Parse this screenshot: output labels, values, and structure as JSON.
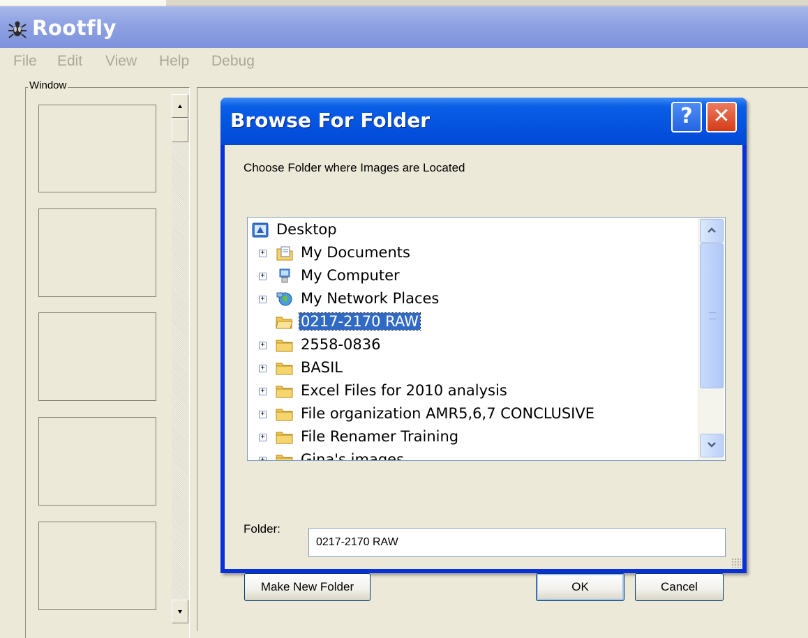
{
  "app": {
    "title": "Rootfly",
    "icon": "bug-icon"
  },
  "menu": {
    "items": [
      {
        "label": "File"
      },
      {
        "label": "Edit"
      },
      {
        "label": "View"
      },
      {
        "label": "Help"
      },
      {
        "label": "Debug"
      }
    ]
  },
  "window_panel": {
    "legend": "Window"
  },
  "dialog": {
    "title": "Browse For Folder",
    "help_symbol": "?",
    "close_symbol": "✕",
    "prompt": "Choose Folder where Images are Located",
    "tree": [
      {
        "label": "Desktop",
        "icon": "desktop-icon",
        "expander": ""
      },
      {
        "label": "My Documents",
        "icon": "my-documents-icon",
        "expander": "+"
      },
      {
        "label": "My Computer",
        "icon": "my-computer-icon",
        "expander": "+"
      },
      {
        "label": "My Network Places",
        "icon": "network-places-icon",
        "expander": "+"
      },
      {
        "label": "0217-2170 RAW",
        "icon": "folder-icon",
        "expander": "",
        "selected": true
      },
      {
        "label": "2558-0836",
        "icon": "folder-icon",
        "expander": "+"
      },
      {
        "label": "BASIL",
        "icon": "folder-icon",
        "expander": "+"
      },
      {
        "label": "Excel Files for 2010 analysis",
        "icon": "folder-icon",
        "expander": "+"
      },
      {
        "label": "File organization AMR5,6,7 CONCLUSIVE",
        "icon": "folder-icon",
        "expander": "+"
      },
      {
        "label": "File Renamer Training",
        "icon": "folder-icon",
        "expander": "+"
      },
      {
        "label": "Gina's images",
        "icon": "folder-icon",
        "expander": "+"
      }
    ],
    "folder_label": "Folder:",
    "folder_value": "0217-2170 RAW",
    "buttons": {
      "make_new_folder": "Make New Folder",
      "ok": "OK",
      "cancel": "Cancel"
    }
  },
  "colors": {
    "xp_blue": "#0453e0",
    "selection": "#316ac5",
    "dialog_face": "#ece9d8",
    "close_red": "#d53b17"
  }
}
